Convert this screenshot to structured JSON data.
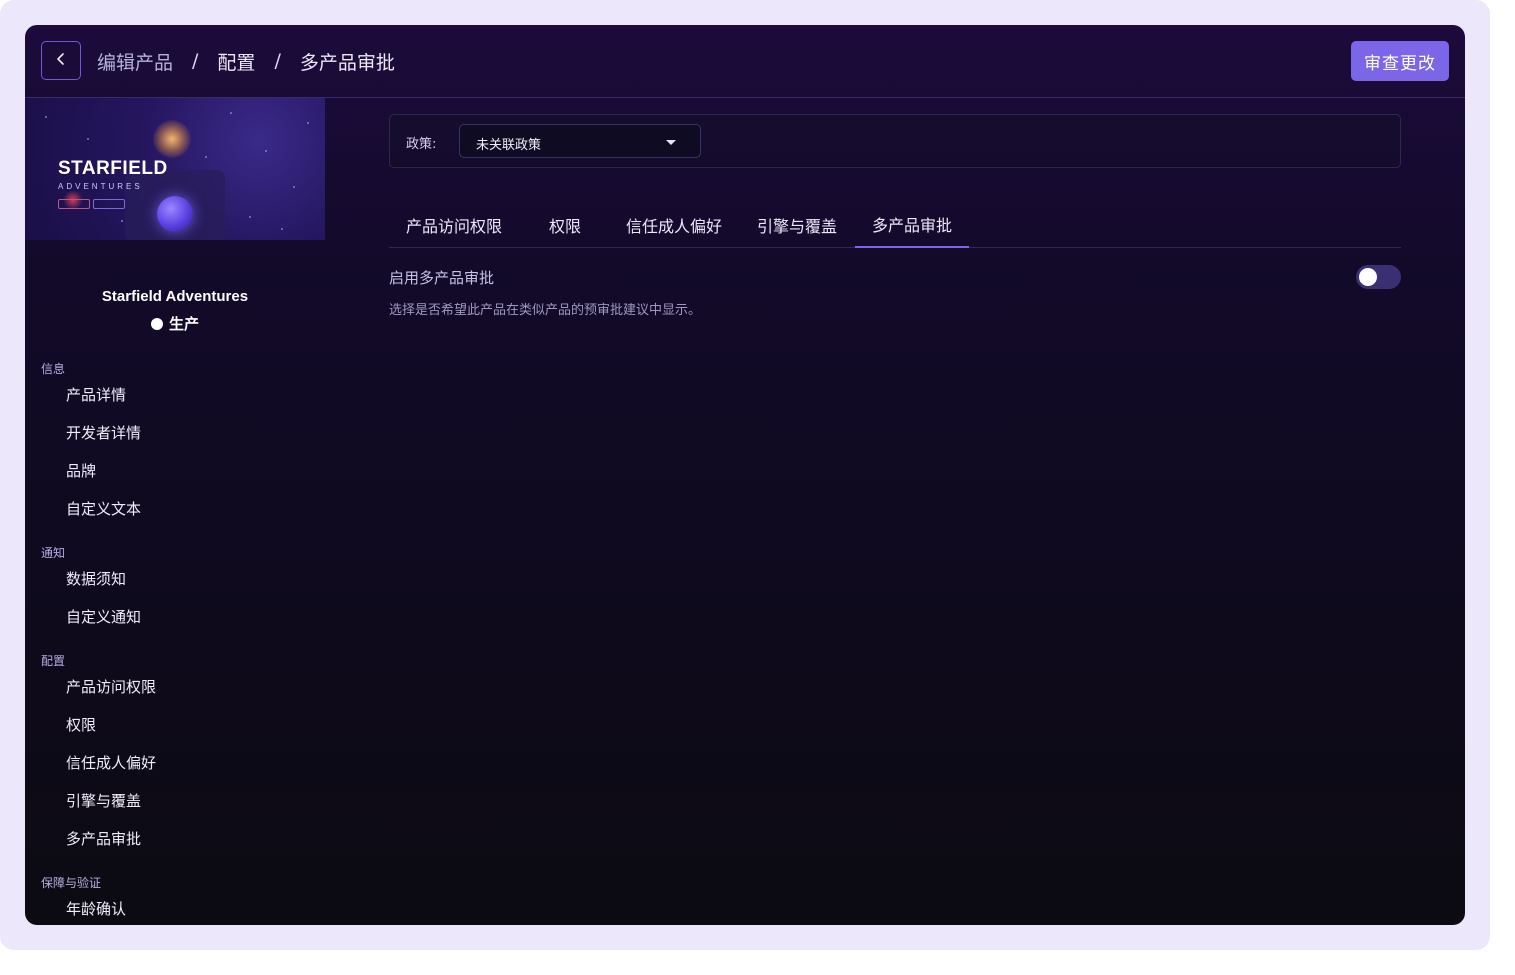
{
  "header": {
    "breadcrumb": [
      "编辑产品",
      "配置",
      "多产品审批"
    ],
    "separator": "/",
    "review_button": "审查更改"
  },
  "product": {
    "banner_title": "STARFIELD",
    "banner_subtitle": "ADVENTURES",
    "name": "Starfield Adventures",
    "status": "生产"
  },
  "sidebar": {
    "sections": [
      {
        "label": "信息",
        "items": [
          "产品详情",
          "开发者详情",
          "品牌",
          "自定义文本"
        ]
      },
      {
        "label": "通知",
        "items": [
          "数据须知",
          "自定义通知"
        ]
      },
      {
        "label": "配置",
        "items": [
          "产品访问权限",
          "权限",
          "信任成人偏好",
          "引擎与覆盖",
          "多产品审批"
        ]
      },
      {
        "label": "保障与验证",
        "items": [
          "年龄确认"
        ]
      }
    ]
  },
  "policy": {
    "label": "政策:",
    "selected": "未关联政策"
  },
  "tabs": {
    "items": [
      "产品访问权限",
      "权限",
      "信任成人偏好",
      "引擎与覆盖",
      "多产品审批"
    ],
    "active_index": 4
  },
  "setting": {
    "title": "启用多产品审批",
    "description": "选择是否希望此产品在类似产品的预审批建议中显示。",
    "enabled": false
  },
  "colors": {
    "accent": "#7b66e8",
    "background_top": "#1c0b3b",
    "background_bottom": "#0c0b12"
  }
}
